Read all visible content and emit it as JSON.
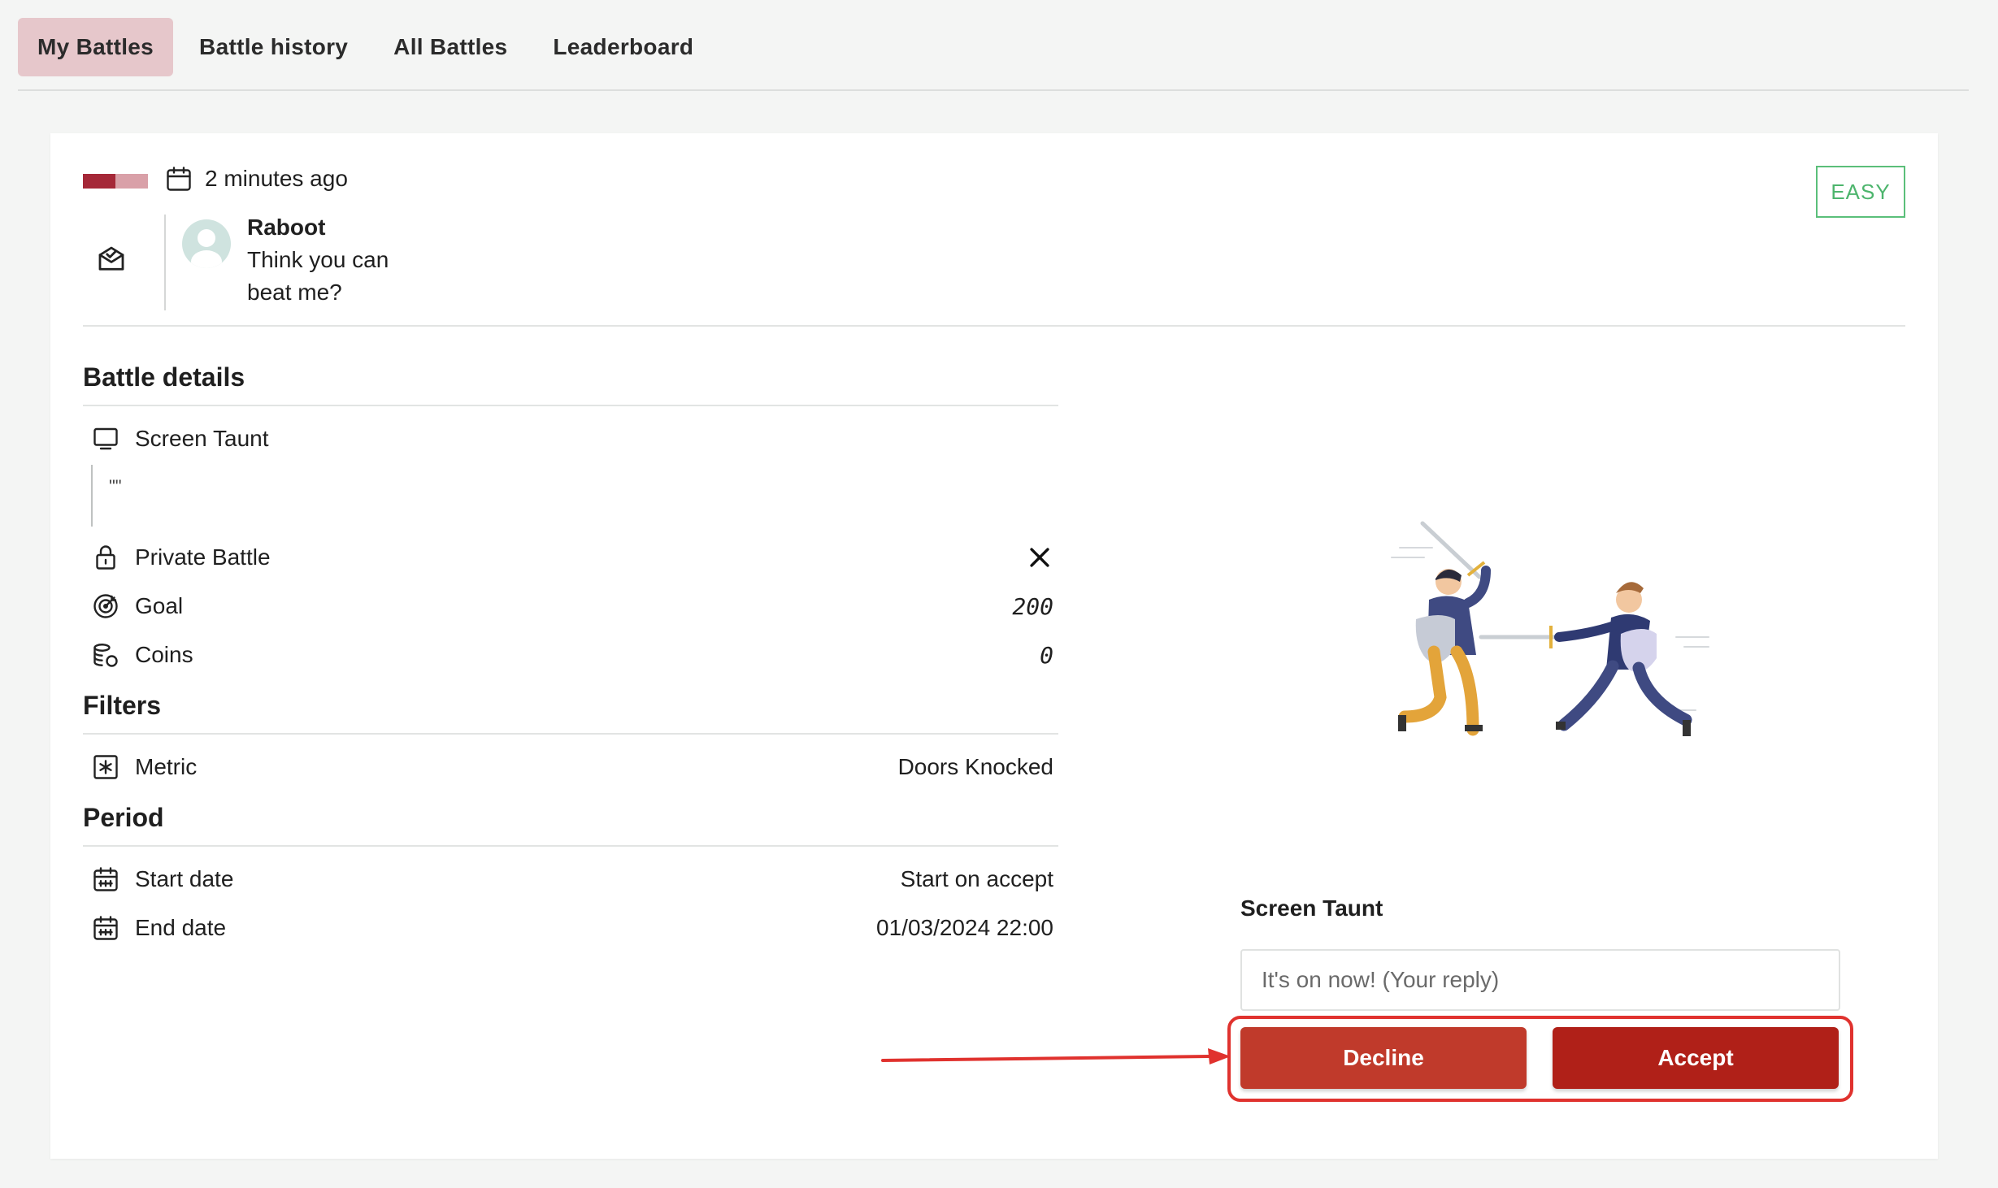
{
  "tabs": [
    {
      "label": "My Battles",
      "active": true
    },
    {
      "label": "Battle history",
      "active": false
    },
    {
      "label": "All Battles",
      "active": false
    },
    {
      "label": "Leaderboard",
      "active": false
    }
  ],
  "battle": {
    "timestamp": "2 minutes ago",
    "difficulty": "EASY",
    "challenger": {
      "name": "Raboot",
      "message": "Think you can beat me?"
    }
  },
  "sections": {
    "battle_details": "Battle details",
    "filters": "Filters",
    "period": "Period"
  },
  "details": {
    "screen_taunt_label": "Screen Taunt",
    "screen_taunt_value": "\"\"",
    "private_battle_label": "Private Battle",
    "goal_label": "Goal",
    "goal_value": "200",
    "coins_label": "Coins",
    "coins_value": "0"
  },
  "filters": {
    "metric_label": "Metric",
    "metric_value": "Doors Knocked"
  },
  "period": {
    "start_label": "Start date",
    "start_value": "Start on accept",
    "end_label": "End date",
    "end_value": "01/03/2024 22:00"
  },
  "reply": {
    "label": "Screen Taunt",
    "placeholder": "It's on now! (Your reply)",
    "decline_label": "Decline",
    "accept_label": "Accept"
  },
  "colors": {
    "accent": "#b02018",
    "decline": "#c03a2b",
    "easy": "#4db56d",
    "active_tab": "#e6c7cb",
    "annotation": "#e0322e"
  },
  "icons": [
    "calendar-icon",
    "mail-icon",
    "monitor-icon",
    "lock-icon",
    "close-icon",
    "target-icon",
    "coins-icon",
    "metric-icon",
    "calendar-range-icon"
  ]
}
